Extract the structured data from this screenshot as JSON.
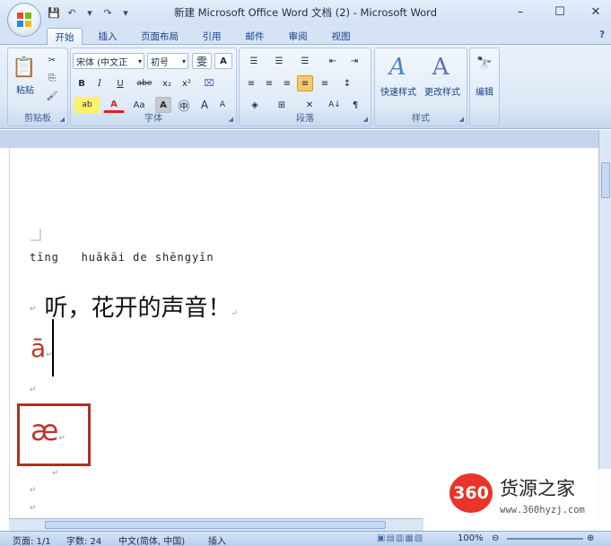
{
  "window": {
    "title": "新建 Microsoft Office Word 文档 (2) - Microsoft Word",
    "minimize": "–",
    "maximize": "☐",
    "close": "✕"
  },
  "qat": {
    "save": "💾",
    "undo": "↶",
    "undo_dd": "▾",
    "redo": "↷",
    "customize": "▾"
  },
  "tabs": [
    "开始",
    "插入",
    "页面布局",
    "引用",
    "邮件",
    "审阅",
    "视图"
  ],
  "help_icon": "?",
  "ribbon": {
    "clipboard": {
      "label": "剪贴板",
      "paste": "粘贴",
      "cut": "✂",
      "copy": "⎘",
      "format_painter": "🖌"
    },
    "font": {
      "label": "字体",
      "font_name": "宋体 (中文正",
      "font_size": "初号",
      "phonetic_guide": "雯",
      "char_border": "A",
      "bold": "B",
      "italic": "I",
      "underline": "U",
      "strike": "abe",
      "subscript": "x₂",
      "superscript": "x²",
      "clear": "⌧",
      "highlight": "ab",
      "font_color": "A",
      "change_case": "Aa",
      "char_shading": "A",
      "enclose": "㊥",
      "grow": "A",
      "shrink": "A"
    },
    "paragraph": {
      "label": "段落",
      "bullets": "☰",
      "numbering": "☰",
      "multilevel": "☰",
      "decrease_indent": "⇤",
      "increase_indent": "⇥",
      "align_left": "≡",
      "center": "≡",
      "align_right": "≡",
      "justify": "≡",
      "distributed": "≡",
      "line_spacing": "↕",
      "shading": "◈",
      "borders": "⊞",
      "asian_layout": "✕",
      "sort": "A↓",
      "show_marks": "¶"
    },
    "styles": {
      "label": "样式",
      "quick_styles": "快速样式",
      "change_styles": "更改样式"
    },
    "editing": {
      "label": "编辑",
      "icon": "🔭"
    }
  },
  "document": {
    "pinyin": "tīng   huākāi de shēngyīn",
    "main_line": "听，花开的声音！",
    "red_char": "ā",
    "boxed_char": "æ",
    "para_mark": "↵"
  },
  "status": {
    "page": "页面: 1/1",
    "words": "字数: 24",
    "language": "中文(简体, 中国)",
    "insert": "插入",
    "zoom": "100%",
    "zoom_out": "⊖",
    "zoom_in": "⊕"
  },
  "watermark": {
    "logo": "360",
    "title": "货源之家",
    "url": "www.360hyzj.com"
  },
  "colors": {
    "accent": "#15428b",
    "red_text": "#c0352b",
    "box_border": "#b03025",
    "logo_red": "#e8342a"
  }
}
